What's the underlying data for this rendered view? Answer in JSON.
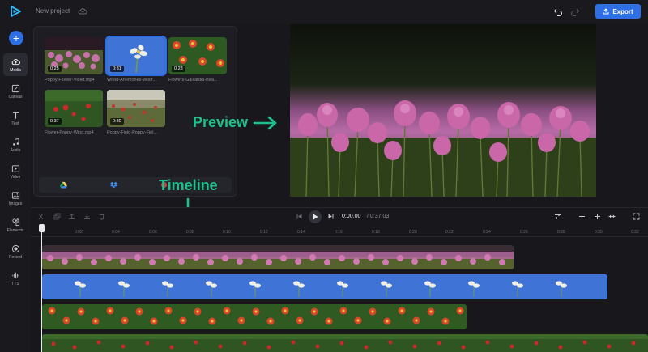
{
  "header": {
    "project_title": "New project",
    "export_label": "Export"
  },
  "sidebar": {
    "items": [
      {
        "label": "Media",
        "icon": "cloud-upload-icon"
      },
      {
        "label": "Canvas",
        "icon": "canvas-icon"
      },
      {
        "label": "Text",
        "icon": "text-icon"
      },
      {
        "label": "Audio",
        "icon": "music-note-icon"
      },
      {
        "label": "Video",
        "icon": "video-icon"
      },
      {
        "label": "Images",
        "icon": "image-icon"
      },
      {
        "label": "Elements",
        "icon": "elements-icon"
      },
      {
        "label": "Record",
        "icon": "record-icon"
      },
      {
        "label": "TTS",
        "icon": "tts-icon"
      }
    ]
  },
  "media": {
    "items": [
      {
        "duration": "0:25",
        "name": "Poppy-Flower-Violet.mp4"
      },
      {
        "duration": "0:31",
        "name": "Wood-Anemones-Wildf..."
      },
      {
        "duration": "0:23",
        "name": "Flowers-Gaillardia-Bea..."
      },
      {
        "duration": "0:37",
        "name": "Flower-Poppy-Wind.mp4"
      },
      {
        "duration": "0:30",
        "name": "Poppy-Field-Poppy-Fiel..."
      }
    ]
  },
  "annotations": {
    "preview": "Preview",
    "timeline": "Timeline"
  },
  "timeline": {
    "current_time": "0:00.00",
    "total_time": "/ 0:37.03",
    "ticks": [
      "0",
      "0:02",
      "0:04",
      "0:06",
      "0:08",
      "0:10",
      "0:12",
      "0:14",
      "0:16",
      "0:18",
      "0:20",
      "0:22",
      "0:24",
      "0:26",
      "0:28",
      "0:30",
      "0:32"
    ]
  },
  "colors": {
    "accent": "#2f6fe5",
    "annotation": "#1ec18a",
    "background": "#17171c"
  }
}
